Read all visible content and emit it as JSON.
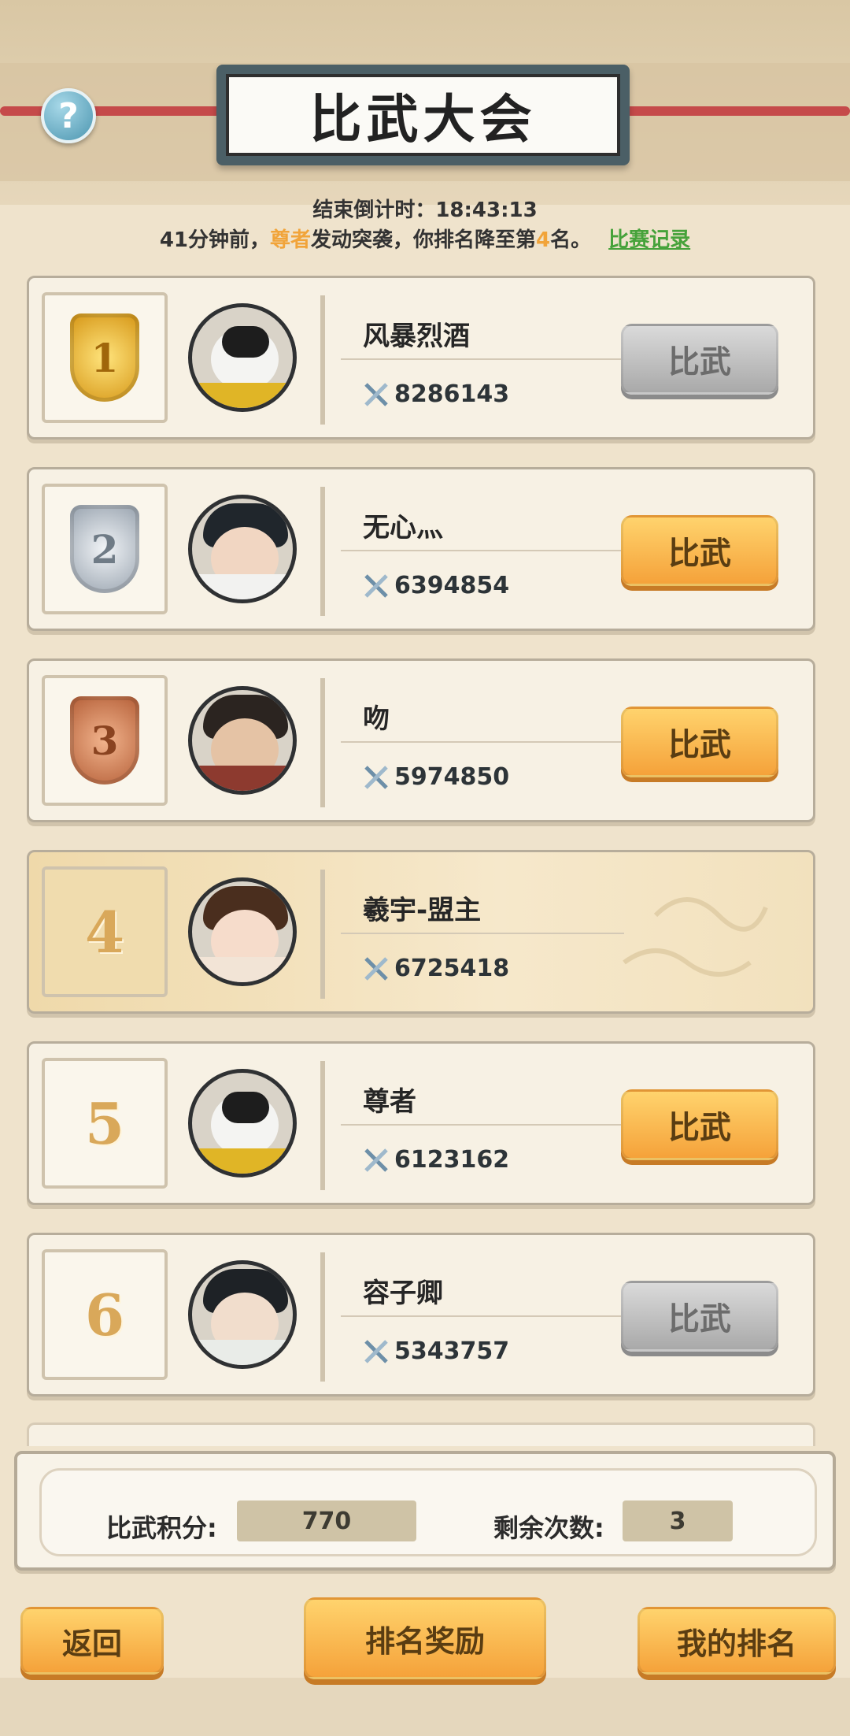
{
  "header": {
    "help_icon": "question-icon",
    "title": "比武大会"
  },
  "countdown": {
    "label": "结束倒计时：",
    "value": "18:43:13"
  },
  "notice": {
    "prefix": "41分钟前，",
    "attacker": "尊者",
    "middle": "发动突袭，你排名降至第",
    "rank": "4",
    "suffix": "名。",
    "record_link": "比赛记录"
  },
  "rankings": [
    {
      "rank": "1",
      "name": "风暴烈酒",
      "power": "8286143",
      "button": "比武",
      "button_enabled": false,
      "medal": "gold"
    },
    {
      "rank": "2",
      "name": "无心灬",
      "power": "6394854",
      "button": "比武",
      "button_enabled": true,
      "medal": "silver"
    },
    {
      "rank": "3",
      "name": "吻",
      "power": "5974850",
      "button": "比武",
      "button_enabled": true,
      "medal": "bronze"
    },
    {
      "rank": "4",
      "name": "羲宇-盟主",
      "power": "6725418",
      "button": "",
      "button_enabled": false,
      "is_self": true
    },
    {
      "rank": "5",
      "name": "尊者",
      "power": "6123162",
      "button": "比武",
      "button_enabled": true
    },
    {
      "rank": "6",
      "name": "容子卿",
      "power": "5343757",
      "button": "比武",
      "button_enabled": false
    }
  ],
  "stats": {
    "points_label": "比武积分:",
    "points_value": "770",
    "remaining_label": "剩余次数:",
    "remaining_value": "3"
  },
  "footer": {
    "back": "返回",
    "rewards": "排名奖励",
    "my_rank": "我的排名"
  },
  "colors": {
    "accent_orange": "#f5a23a",
    "highlight_orange": "#f1a43a",
    "link_green": "#46a23a",
    "disabled_grey": "#a9a9a9"
  }
}
